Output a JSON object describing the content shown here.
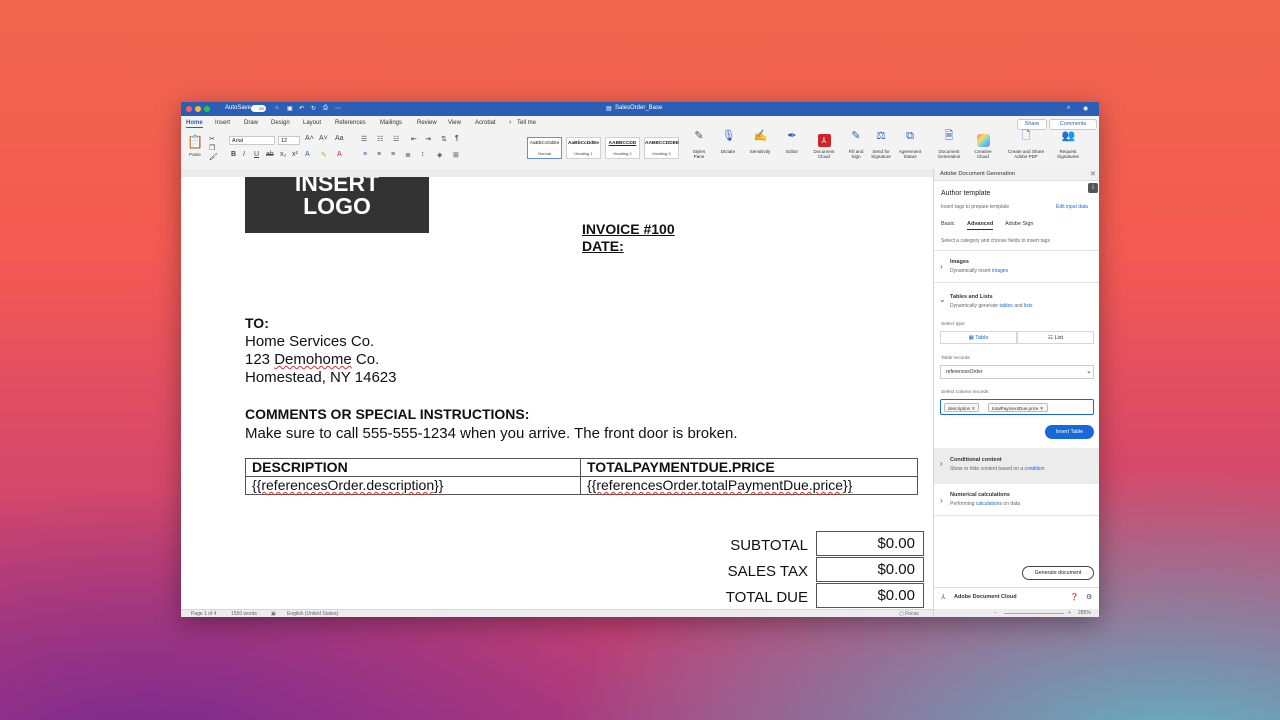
{
  "titlebar": {
    "autosave_label": "AutoSave",
    "autosave_state": "on",
    "doc_title": "SalesOrder_Base"
  },
  "tabs": [
    "Home",
    "Insert",
    "Draw",
    "Design",
    "Layout",
    "References",
    "Mailings",
    "Review",
    "View",
    "Acrobat"
  ],
  "tell_me": "Tell me",
  "share_label": "Share",
  "comments_label": "Comments",
  "ribbon": {
    "paste_label": "Paste",
    "font_name": "Arial",
    "font_size": "12",
    "styles": [
      {
        "preview": "AaBbCcDdEe",
        "name": "Normal"
      },
      {
        "preview": "AaBbCcDdEe",
        "name": "Heading 1"
      },
      {
        "preview": "AABBCCDD",
        "name": "Heading 2"
      },
      {
        "preview": "AABBCCDDEE",
        "name": "Heading 3"
      }
    ],
    "buttons": [
      {
        "label": "Styles Pane"
      },
      {
        "label": "Dictate"
      },
      {
        "label": "Sensitivity"
      },
      {
        "label": "Editor"
      },
      {
        "label": "Document Cloud"
      },
      {
        "label": "Fill and Sign"
      },
      {
        "label": "Send for Signature"
      },
      {
        "label": "Agreement Status"
      },
      {
        "label": "Document Generation"
      },
      {
        "label": "Creative Cloud"
      },
      {
        "label": "Create and Share Adobe PDF"
      },
      {
        "label": "Request Signatures"
      }
    ]
  },
  "document": {
    "logo_line1": "INSERT",
    "logo_line2": "LOGO",
    "invoice": "INVOICE #100",
    "date": "DATE:",
    "to_label": "TO:",
    "to_name": "Home Services Co.",
    "to_addr1_prefix": "123 ",
    "to_addr1_word": "Demohome",
    "to_addr1_suffix": " Co.",
    "to_addr2": "Homestead, NY 14623",
    "comments_label": "COMMENTS OR SPECIAL INSTRUCTIONS:",
    "comments_text": "Make sure to call 555-555-1234 when you arrive. The front door is broken.",
    "table_headers": [
      "DESCRIPTION",
      "TOTALPAYMENTDUE.PRICE"
    ],
    "table_row": [
      "{{referencesOrder.description}}",
      "{{referencesOrder.totalPaymentDue.price}}"
    ],
    "totals": [
      {
        "label": "SUBTOTAL",
        "value": "$0.00"
      },
      {
        "label": "SALES TAX",
        "value": "$0.00"
      },
      {
        "label": "TOTAL DUE",
        "value": "$0.00"
      }
    ]
  },
  "statusbar": {
    "page": "Page 1 of 4",
    "words": "1550 words",
    "language": "English (United States)",
    "focus": "Focus",
    "zoom": "285%"
  },
  "panel": {
    "header": "Adobe Document Generation",
    "title": "Author template",
    "subtitle": "Insert tags to prepare template",
    "edit_link": "Edit input data",
    "tabs": [
      "Basic",
      "Advanced",
      "Adobe Sign"
    ],
    "instruction": "Select a category and choose fields to insert tags",
    "images_title": "Images",
    "images_desc_prefix": "Dynamically insert ",
    "images_desc_link": "images",
    "tl_title": "Tables and Lists",
    "tl_desc_prefix": "Dynamically generate ",
    "tl_desc_link1": "tables",
    "tl_desc_mid": " and ",
    "tl_desc_link2": "lists",
    "select_type_label": "Select type",
    "type_table": "Table",
    "type_list": "List",
    "table_records_label": "Table records",
    "table_records_value": "referencesOrder",
    "column_records_label": "Select column records",
    "chips": [
      "description",
      "totalPaymentDue.price"
    ],
    "insert_table": "Insert Table",
    "cond_title": "Conditional content",
    "cond_desc_prefix": "Show or hide content based on a ",
    "cond_desc_link": "condition",
    "num_title": "Numerical calculations",
    "num_desc_prefix": "Performing ",
    "num_desc_link": "calculations",
    "num_desc_suffix": " on data",
    "generate_btn": "Generate document",
    "footer": "Adobe Document Cloud"
  },
  "colors": {
    "accent": "#2b5eb5",
    "link": "#1769d8",
    "logo_bg": "#333333"
  }
}
